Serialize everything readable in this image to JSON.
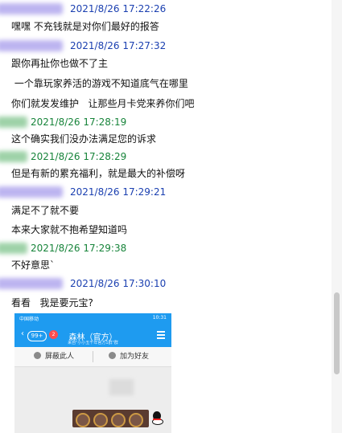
{
  "messages": [
    {
      "time": "2021/8/26 17:22:26",
      "sender_color": "blue",
      "lines": [
        "嘿嘿  不充钱就是对你们最好的报答"
      ]
    },
    {
      "time": "2021/8/26 17:27:32",
      "sender_color": "blue",
      "lines": [
        "跟你再扯你也做不了主",
        " 一个靠玩家养活的游戏不知道底气在哪里",
        "你们就发发维护   让那些月卡党来养你们吧"
      ]
    },
    {
      "time": "2021/8/26 17:28:19",
      "sender_color": "green",
      "lines": [
        "这个确实我们没办法满足您的诉求"
      ]
    },
    {
      "time": "2021/8/26 17:28:29",
      "sender_color": "green",
      "lines": [
        "但是有新的累充福利，就是最大的补偿呀"
      ]
    },
    {
      "time": "2021/8/26 17:29:21",
      "sender_color": "blue",
      "lines": [
        "满足不了就不要",
        "本来大家就不抱希望知道吗"
      ]
    },
    {
      "time": "2021/8/26 17:29:38",
      "sender_color": "green",
      "lines": [
        "不好意思`"
      ]
    },
    {
      "time": "2021/8/26 17:30:10",
      "sender_color": "blue",
      "lines": [
        "看看   我是要元宝?"
      ]
    }
  ],
  "colors": {
    "blue_ts": "#1a3fb0",
    "green_ts": "#17843a",
    "qq_blue": "#1e9bf0"
  },
  "embedded_screenshot": {
    "status_left": "中国移动",
    "status_right": "10:31",
    "back_count": "99+",
    "unread": "2",
    "title": "森林（官方）",
    "subtitle": "来自\"小小五千年官方1群\"群",
    "block_label": "屏蔽此人",
    "add_friend_label": "加为好友",
    "icons": [
      "back-chevron-icon",
      "menu-icon",
      "block-user-icon",
      "add-friend-icon",
      "qq-penguin-icon"
    ]
  }
}
